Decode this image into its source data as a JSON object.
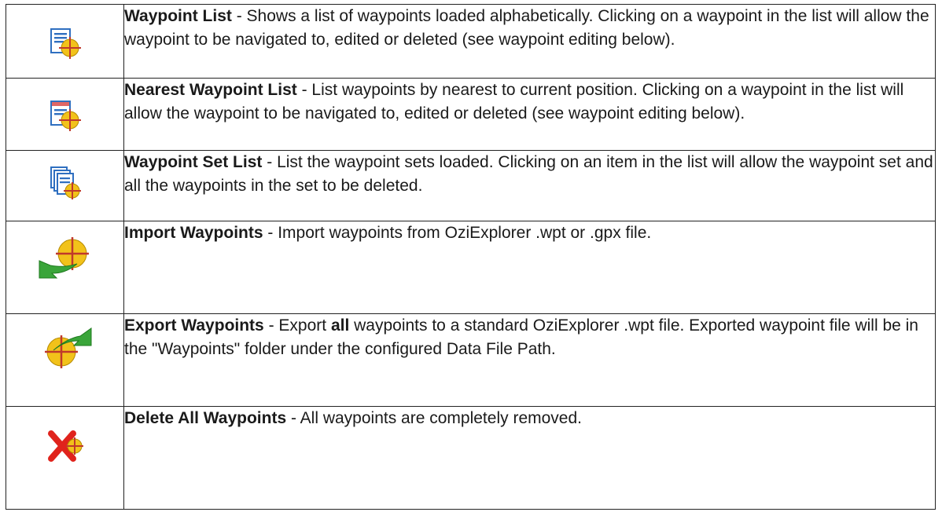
{
  "rows": [
    {
      "icon": "waypoint-list-icon",
      "title": "Waypoint List",
      "desc_before": " - Shows a list of waypoints loaded alphabetically. Clicking on a waypoint in the list will allow the waypoint to be navigated to, edited or deleted (see waypoint editing below).",
      "bold_word": "",
      "desc_after": ""
    },
    {
      "icon": "nearest-waypoint-list-icon",
      "title": "Nearest Waypoint List",
      "desc_before": " - List waypoints by nearest to current position. Clicking on a waypoint in the list will allow the waypoint to be navigated to, edited or deleted (see waypoint editing below).",
      "bold_word": "",
      "desc_after": ""
    },
    {
      "icon": "waypoint-set-list-icon",
      "title": "Waypoint Set List",
      "desc_before": " - List the waypoint sets loaded. Clicking on an item in the list will allow the waypoint set and all the waypoints in the set to be deleted.",
      "bold_word": "",
      "desc_after": ""
    },
    {
      "icon": "import-waypoints-icon",
      "title": "Import Waypoints",
      "desc_before": " - Import waypoints from OziExplorer .wpt or .gpx file.",
      "bold_word": "",
      "desc_after": ""
    },
    {
      "icon": "export-waypoints-icon",
      "title": "Export Waypoints",
      "desc_before": " - Export ",
      "bold_word": "all",
      "desc_after": " waypoints to a standard OziExplorer .wpt file. Exported waypoint file will be in the \"Waypoints\" folder under the configured Data File Path."
    },
    {
      "icon": "delete-all-waypoints-icon",
      "title": "Delete All Waypoints",
      "desc_before": " - All waypoints are completely removed.",
      "bold_word": "",
      "desc_after": ""
    }
  ],
  "colors": {
    "doc_blue": "#2f6fc0",
    "waypoint_yellow": "#f2c21a",
    "waypoint_red": "#d9352b",
    "arrow_green": "#3aa53a",
    "delete_red": "#e0231c"
  }
}
